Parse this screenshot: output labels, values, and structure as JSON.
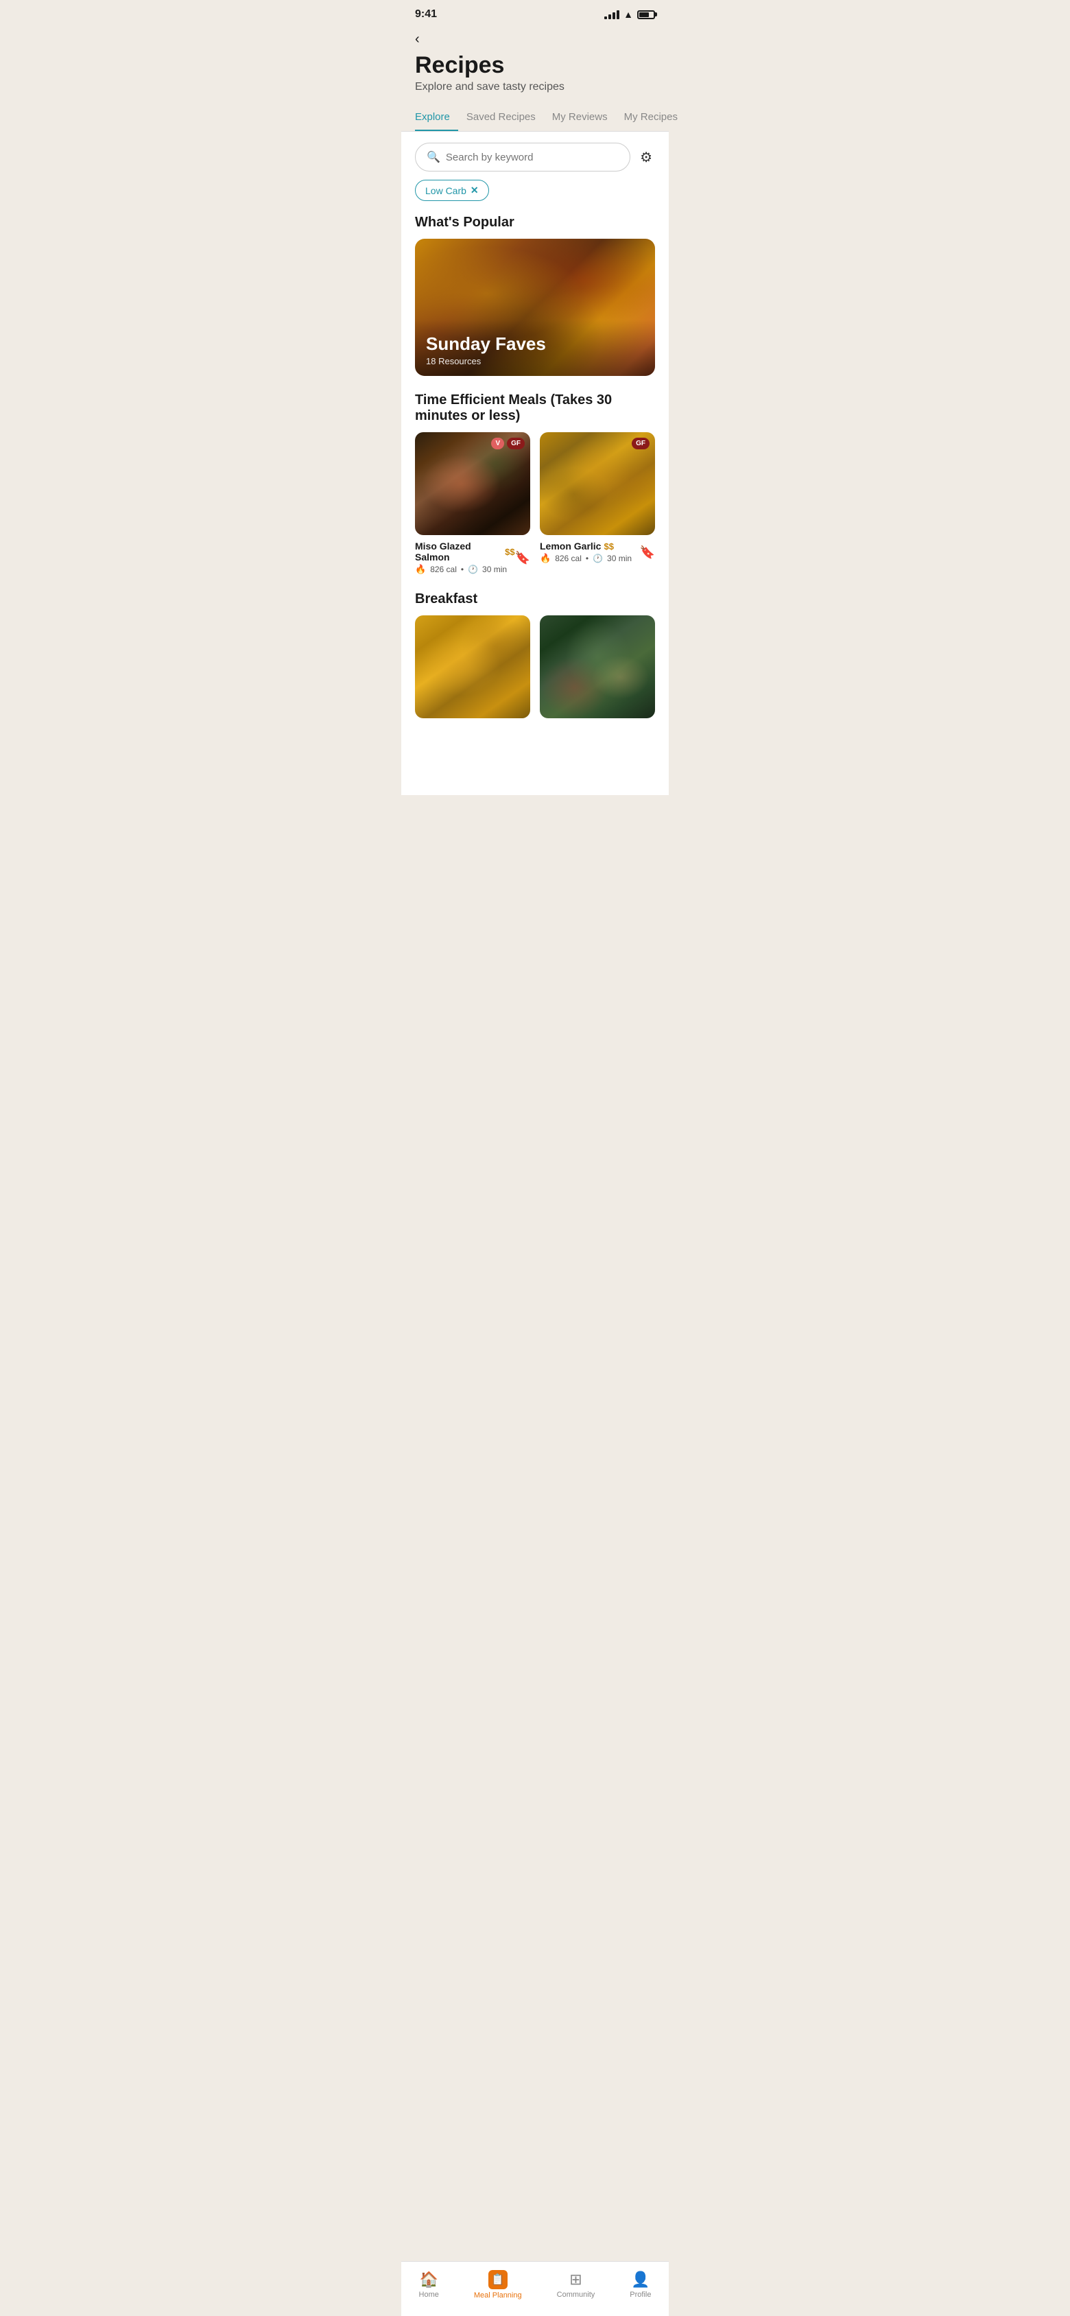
{
  "statusBar": {
    "time": "9:41"
  },
  "header": {
    "title": "Recipes",
    "subtitle": "Explore and save tasty recipes",
    "backLabel": "‹"
  },
  "tabs": [
    {
      "label": "Explore",
      "active": true
    },
    {
      "label": "Saved Recipes",
      "active": false
    },
    {
      "label": "My Reviews",
      "active": false
    },
    {
      "label": "My Recipes",
      "active": false
    }
  ],
  "search": {
    "placeholder": "Search by keyword"
  },
  "activeFilters": [
    {
      "label": "Low Carb"
    }
  ],
  "popularSection": {
    "title": "What's Popular",
    "card": {
      "title": "Sunday Faves",
      "subtitle": "18 Resources"
    }
  },
  "timeEfficientSection": {
    "title": "Time Efficient Meals (Takes 30 minutes or less)",
    "recipes": [
      {
        "name": "Miso Glazed Salmon",
        "price": "$$",
        "calories": "826 cal",
        "time": "30 min",
        "badges": [
          "V",
          "GF"
        ],
        "imgClass": "salmon"
      },
      {
        "name": "Lemon Garlic",
        "price": "$$",
        "calories": "826 cal",
        "time": "30 min",
        "badges": [
          "GF"
        ],
        "imgClass": "chicken"
      }
    ]
  },
  "breakfastSection": {
    "title": "Breakfast",
    "recipes": [
      {
        "imgClass": "breakfast1"
      },
      {
        "imgClass": "breakfast2"
      }
    ]
  },
  "bottomNav": [
    {
      "label": "Home",
      "icon": "🏠",
      "active": false,
      "name": "home"
    },
    {
      "label": "Meal Planning",
      "icon": "📋",
      "active": true,
      "name": "meal-planning"
    },
    {
      "label": "Community",
      "icon": "⊞",
      "active": false,
      "name": "community"
    },
    {
      "label": "Profile",
      "icon": "👤",
      "active": false,
      "name": "profile"
    }
  ]
}
